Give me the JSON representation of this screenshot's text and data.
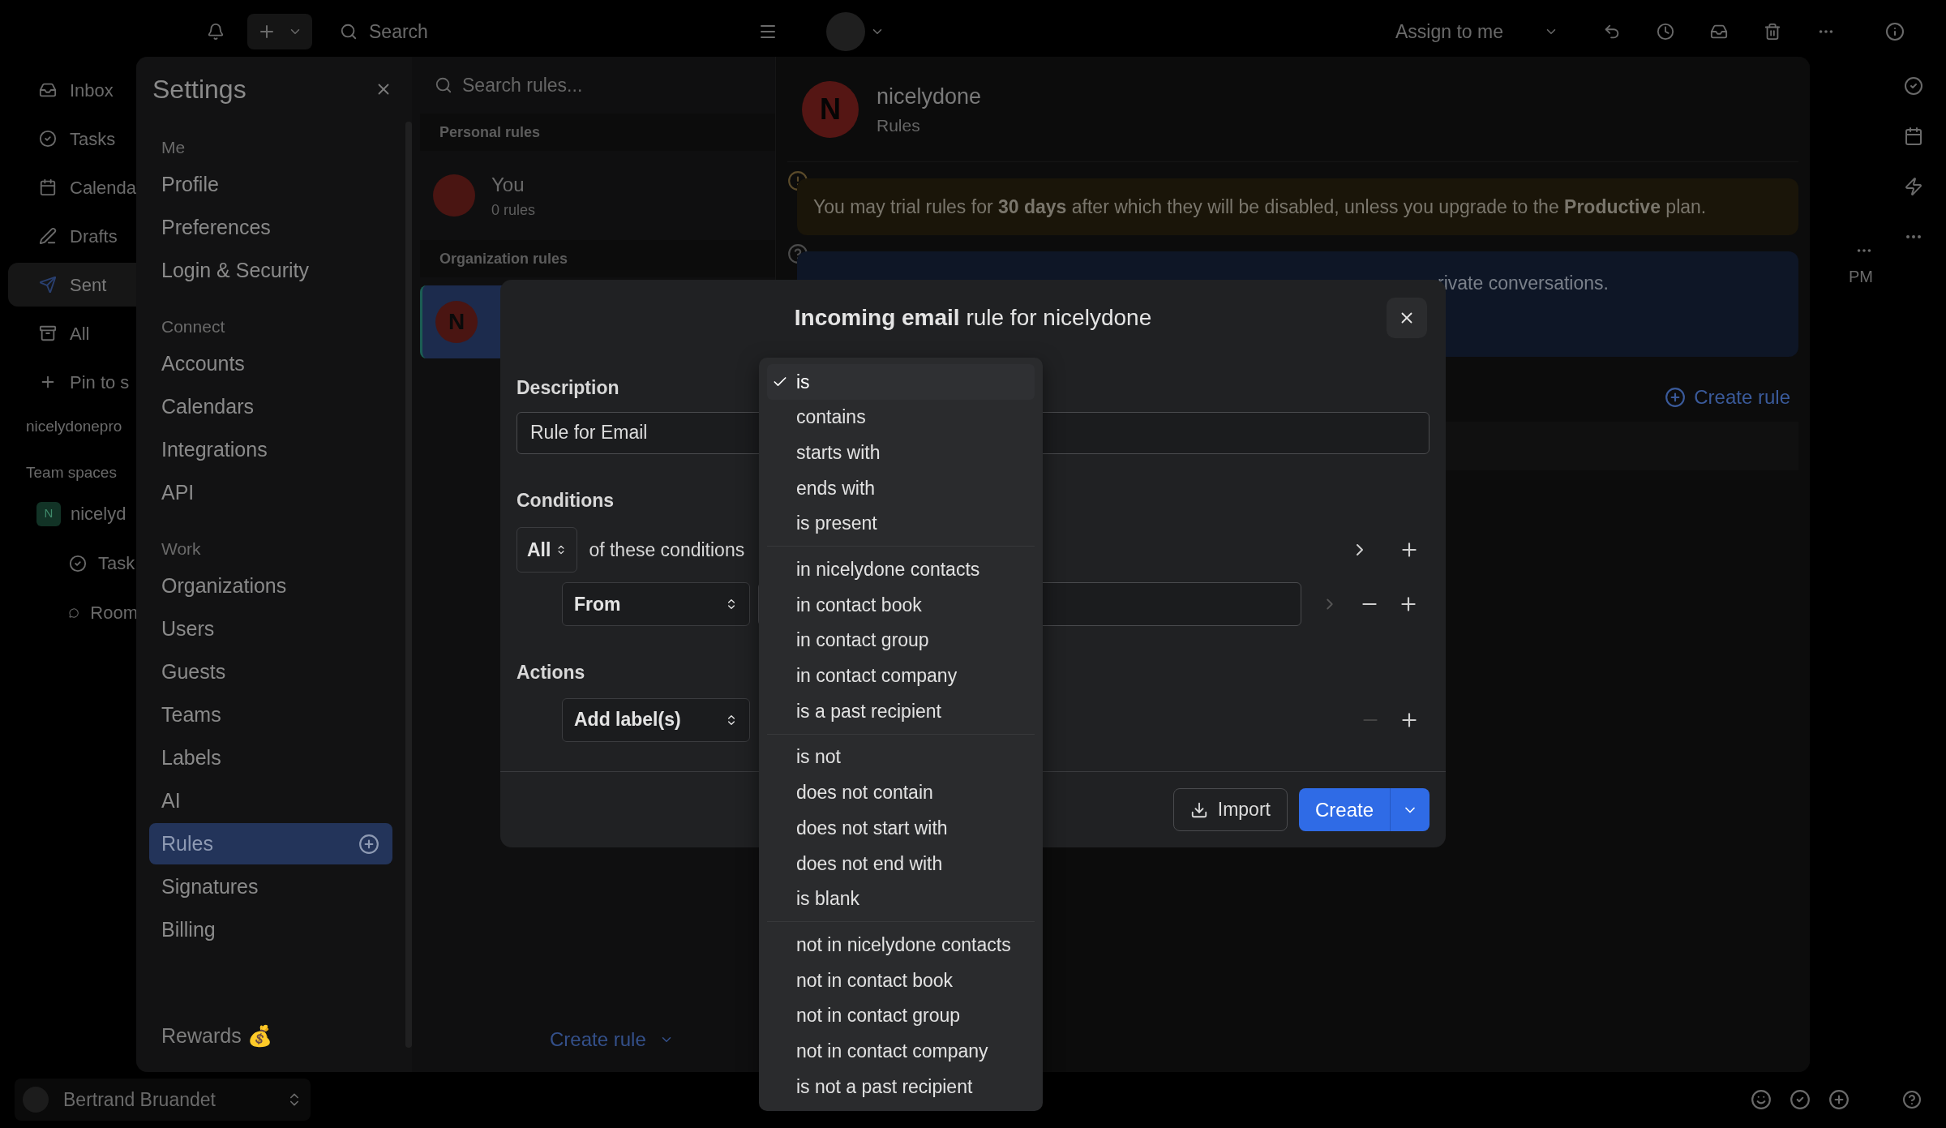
{
  "top_bar": {
    "search_placeholder": "Search",
    "assign_button": "Assign to me"
  },
  "sidebar": {
    "items": [
      {
        "label": "Inbox",
        "selected": false
      },
      {
        "label": "Tasks",
        "selected": false
      },
      {
        "label": "Calenda",
        "selected": false
      },
      {
        "label": "Drafts",
        "selected": false
      },
      {
        "label": "Sent",
        "selected": true
      },
      {
        "label": "All",
        "selected": false
      }
    ],
    "pin": "Pin to s",
    "workspace": "nicelydonepro",
    "team_spaces": "Team spaces",
    "team": {
      "initial": "N",
      "label": "nicelyd",
      "children": [
        {
          "label": "Task"
        },
        {
          "label": "Room"
        }
      ]
    },
    "user": "Bertrand Bruandet"
  },
  "settings": {
    "title": "Settings",
    "sections": [
      {
        "heading": "Me",
        "items": [
          {
            "label": "Profile",
            "selected": false
          },
          {
            "label": "Preferences",
            "selected": false
          },
          {
            "label": "Login & Security",
            "selected": false
          }
        ]
      },
      {
        "heading": "Connect",
        "items": [
          {
            "label": "Accounts",
            "selected": false
          },
          {
            "label": "Calendars",
            "selected": false
          },
          {
            "label": "Integrations",
            "selected": false
          },
          {
            "label": "API",
            "selected": false
          }
        ]
      },
      {
        "heading": "Work",
        "items": [
          {
            "label": "Organizations",
            "selected": false
          },
          {
            "label": "Users",
            "selected": false
          },
          {
            "label": "Guests",
            "selected": false
          },
          {
            "label": "Teams",
            "selected": false
          },
          {
            "label": "Labels",
            "selected": false
          },
          {
            "label": "AI",
            "selected": false
          },
          {
            "label": "Rules",
            "selected": true
          },
          {
            "label": "Signatures",
            "selected": false
          },
          {
            "label": "Billing",
            "selected": false
          }
        ]
      }
    ],
    "rewards": "Rewards 💰"
  },
  "rules_list": {
    "search_placeholder": "Search rules...",
    "groups": [
      {
        "heading": "Personal rules",
        "items": [
          {
            "name": "You",
            "count": "0 rules",
            "selected": false
          }
        ]
      },
      {
        "heading": "Organization rules",
        "items": [
          {
            "initial": "N",
            "selected": true
          }
        ]
      }
    ],
    "create_button": "Create rule"
  },
  "detail": {
    "initial": "N",
    "name": "nicelydone",
    "subtitle": "Rules",
    "warning": "You may trial rules for **30 days** after which they will be disabled, unless you upgrade to the **Productive** plan.",
    "info": "rivate conversations.",
    "create_link": "Create rule",
    "side_time": "PM"
  },
  "dialog": {
    "title": "**Incoming email** rule for nicelydone",
    "description_label": "Description",
    "description_value": "Rule for Email",
    "conditions_label": "Conditions",
    "match": "All",
    "match_suffix": "of these conditions",
    "condition_field": "From",
    "actions_label": "Actions",
    "action": "Add label(s)",
    "import_button": "Import",
    "create_button": "Create"
  },
  "dropdown": {
    "groups": [
      {
        "items": [
          {
            "label": "is",
            "selected": true
          },
          {
            "label": "contains",
            "selected": false
          },
          {
            "label": "starts with",
            "selected": false
          },
          {
            "label": "ends with",
            "selected": false
          },
          {
            "label": "is present",
            "selected": false
          }
        ]
      },
      {
        "items": [
          {
            "label": "in nicelydone contacts",
            "selected": false
          },
          {
            "label": "in contact book",
            "selected": false
          },
          {
            "label": "in contact group",
            "selected": false
          },
          {
            "label": "in contact company",
            "selected": false
          },
          {
            "label": "is a past recipient",
            "selected": false
          }
        ]
      },
      {
        "items": [
          {
            "label": "is not",
            "selected": false
          },
          {
            "label": "does not contain",
            "selected": false
          },
          {
            "label": "does not start with",
            "selected": false
          },
          {
            "label": "does not end with",
            "selected": false
          },
          {
            "label": "is blank",
            "selected": false
          }
        ]
      },
      {
        "items": [
          {
            "label": "not in nicelydone contacts",
            "selected": false
          },
          {
            "label": "not in contact book",
            "selected": false
          },
          {
            "label": "not in contact group",
            "selected": false
          },
          {
            "label": "not in contact company",
            "selected": false
          },
          {
            "label": "is not a past recipient",
            "selected": false
          }
        ]
      }
    ]
  }
}
